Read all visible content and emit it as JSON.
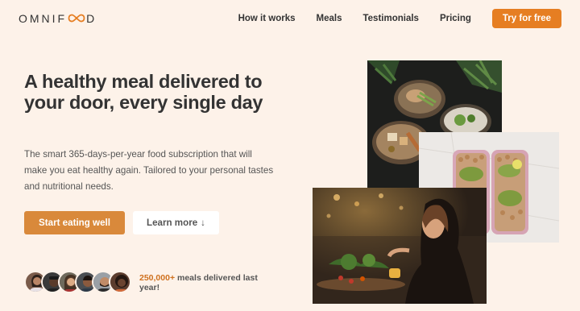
{
  "brand": {
    "name_before": "OMNIF",
    "name_after": "D"
  },
  "nav": {
    "items": [
      "How it works",
      "Meals",
      "Testimonials",
      "Pricing"
    ],
    "cta_label": "Try for free"
  },
  "hero": {
    "title": "A healthy meal delivered to your door, every single day",
    "description": "The smart 365-days-per-year food subscription that will make you eat healthy again. Tailored to your personal tastes and nutritional needs.",
    "primary_button": "Start eating well",
    "secondary_button": "Learn more",
    "secondary_arrow": "↓"
  },
  "delivered": {
    "count": "250,000+",
    "text": " meals delivered last year!"
  },
  "colors": {
    "background": "#fdf2e9",
    "accent": "#e67e22",
    "primary_button": "#d9893b"
  },
  "icons": [
    "infinity-logo-icon",
    "arrow-down-icon"
  ]
}
